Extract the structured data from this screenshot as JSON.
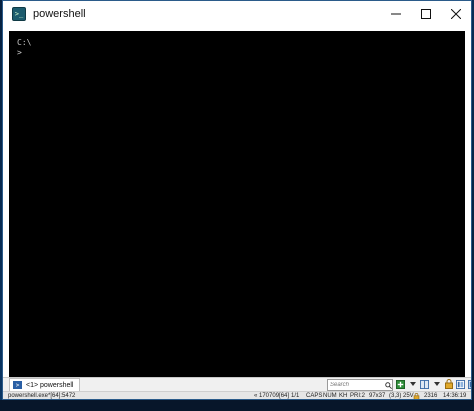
{
  "window": {
    "title": "powershell",
    "controls": {
      "minimize_icon": "minimize-icon",
      "maximize_icon": "maximize-icon",
      "close_icon": "close-icon"
    }
  },
  "console": {
    "lines": [
      "C:\\",
      ">"
    ],
    "background": "#000000",
    "foreground": "#c8c8c8"
  },
  "tabbar": {
    "tabs": [
      {
        "label": "<1> powershell",
        "icon": "powershell-icon"
      }
    ],
    "search": {
      "placeholder": "Search",
      "value": ""
    }
  },
  "statusbar": {
    "process": "powershell.exe*[64]:5472",
    "build": "« 170709[64]",
    "pos": "1/1",
    "caps": "CAPS",
    "num": "NUM",
    "kbd": "KH",
    "pri": "PRI:2",
    "size": "97x37",
    "cursor": "(3,3) 25V",
    "pid": "2316",
    "time": "14:36:19"
  },
  "colors": {
    "accent": "#2b5b8a",
    "desktop": "#0b3a6b"
  }
}
